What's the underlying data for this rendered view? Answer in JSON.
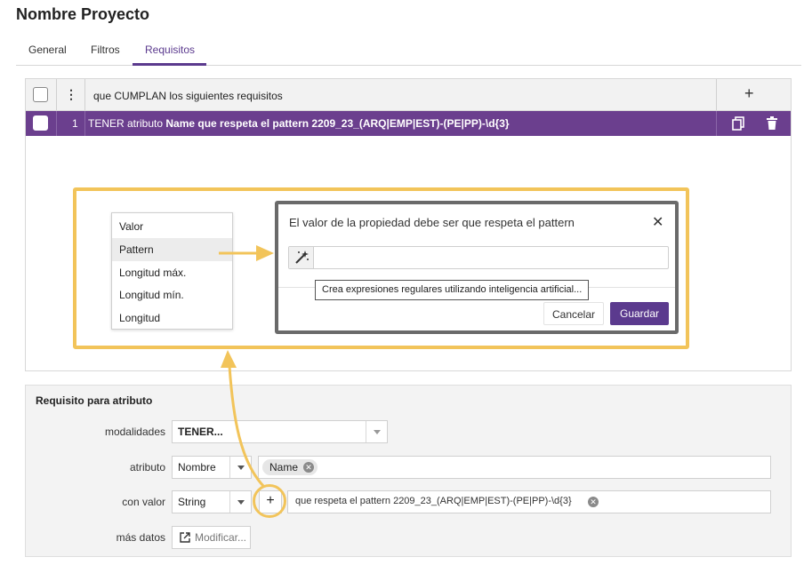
{
  "project": {
    "title": "Nombre Proyecto"
  },
  "tabs": [
    {
      "label": "General"
    },
    {
      "label": "Filtros"
    },
    {
      "label": "Requisitos"
    }
  ],
  "requirements": {
    "header_text": "que CUMPLAN los siguientes requisitos",
    "add_icon": "plus-icon",
    "rows": [
      {
        "number": "1",
        "prefix": "TENER atributo ",
        "bold_text": "Name que respeta el pattern 2209_23_(ARQ|EMP|EST)-(PE|PP)-\\d{3}",
        "icons": [
          "copy-icon",
          "trash-icon"
        ]
      }
    ]
  },
  "dropdown": {
    "items": [
      "Valor",
      "Pattern",
      "Longitud máx.",
      "Longitud mín.",
      "Longitud"
    ],
    "selected": "Pattern"
  },
  "modal": {
    "title": "El valor de la propiedad debe ser que respeta el pattern",
    "input_value": "",
    "wand_icon": "magic-wand-icon",
    "tooltip": "Crea expresiones regulares utilizando inteligencia artificial...",
    "cancel_label": "Cancelar",
    "save_label": "Guardar"
  },
  "attribute_requirement": {
    "title": "Requisito para atributo",
    "modalidades": {
      "label": "modalidades",
      "value": "TENER..."
    },
    "atributo": {
      "label": "atributo",
      "select": "Nombre",
      "chip": "Name"
    },
    "con_valor": {
      "label": "con valor",
      "select": "String",
      "add": "+",
      "chip": "que respeta el pattern 2209_23_(ARQ|EMP|EST)-(PE|PP)-\\d{3}"
    },
    "mas_datos": {
      "label": "más datos",
      "button": "Modificar..."
    }
  },
  "colors": {
    "accent": "#5b3a8e",
    "row_bg": "#6b3f8e",
    "highlight": "#f2c45a"
  }
}
